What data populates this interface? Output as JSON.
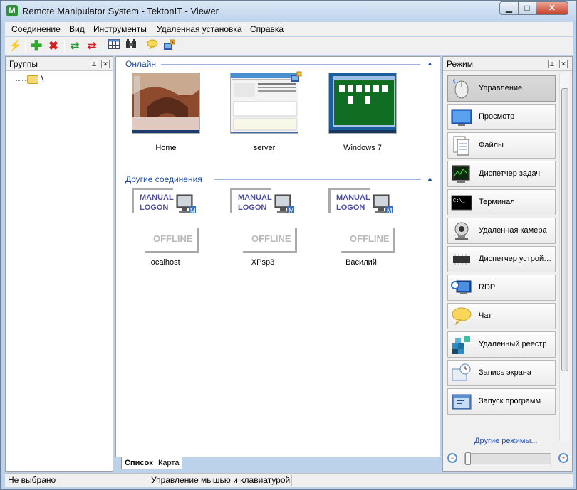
{
  "window": {
    "title": "Remote Manipulator System - TektonIT - Viewer",
    "minimize": "▁",
    "maximize": "□",
    "close": "✕"
  },
  "menu": [
    "Соединение",
    "Вид",
    "Инструменты",
    "Удаленная установка",
    "Справка"
  ],
  "toolbar": {
    "icons": [
      "lightning-icon",
      "add-icon",
      "delete-icon",
      "refresh-icon",
      "refresh-red-icon",
      "grid-icon",
      "binoculars-icon",
      "chat-bubble-icon",
      "keys-icon"
    ]
  },
  "groups_panel": {
    "title": "Группы",
    "root_label": "\\"
  },
  "center": {
    "online_title": "Онлайн",
    "other_title": "Другие соединения",
    "online_hosts": [
      {
        "label": "Home"
      },
      {
        "label": "server"
      },
      {
        "label": "Windows 7"
      }
    ],
    "other_hosts": [
      {
        "label": "localhost",
        "badge_line1": "MANUAL",
        "badge_line2": "LOGON",
        "status": "OFFLINE"
      },
      {
        "label": "XPsp3",
        "badge_line1": "MANUAL",
        "badge_line2": "LOGON",
        "status": "OFFLINE"
      },
      {
        "label": "Василий",
        "badge_line1": "MANUAL",
        "badge_line2": "LOGON",
        "status": "OFFLINE"
      }
    ]
  },
  "tabs": [
    "Список",
    "Карта"
  ],
  "mode_panel": {
    "title": "Режим",
    "modes": [
      {
        "label": "Управление",
        "icon": "mouse-icon",
        "selected": true
      },
      {
        "label": "Просмотр",
        "icon": "screen-icon"
      },
      {
        "label": "Файлы",
        "icon": "files-icon"
      },
      {
        "label": "Диспетчер задач",
        "icon": "task-manager-icon"
      },
      {
        "label": "Терминал",
        "icon": "terminal-icon"
      },
      {
        "label": "Удаленная камера",
        "icon": "webcam-icon"
      },
      {
        "label": "Диспетчер устройств",
        "icon": "chip-icon"
      },
      {
        "label": "RDP",
        "icon": "rdp-icon"
      },
      {
        "label": "Чат",
        "icon": "chat-icon"
      },
      {
        "label": "Удаленный реестр",
        "icon": "registry-icon"
      },
      {
        "label": "Запись экрана",
        "icon": "screen-record-icon"
      },
      {
        "label": "Запуск программ",
        "icon": "run-program-icon"
      }
    ],
    "more_link": "Другие режимы...",
    "zoom_value": 0.0
  },
  "status": {
    "left": "Не выбрано",
    "right": "Управление мышью и клавиатурой"
  },
  "colors": {
    "section_title": "#1b4aa5",
    "offline_text": "#b9b9b9",
    "manual_logon_text": "#4d4ea2"
  }
}
